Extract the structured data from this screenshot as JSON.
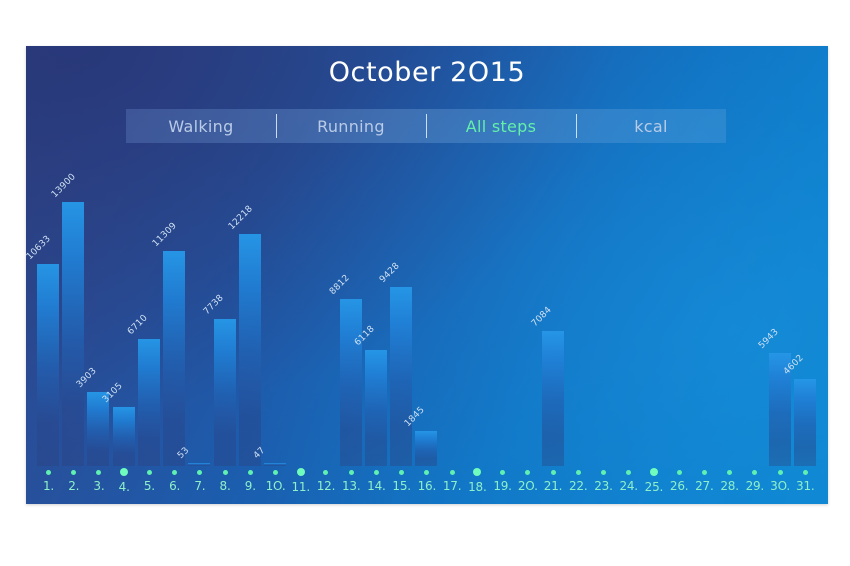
{
  "header": {
    "title": "October 2O15"
  },
  "tabs": [
    {
      "label": "Walking",
      "active": false
    },
    {
      "label": "Running",
      "active": false
    },
    {
      "label": "All steps",
      "active": true
    },
    {
      "label": "kcal",
      "active": false
    }
  ],
  "colors": {
    "accent_green": "#63f0a8",
    "dot_green": "#5ff0b2",
    "axis_label": "#8df0c8",
    "bar_blue": "#2696e6",
    "title_white": "#ffffff",
    "tab_inactive": "#b9cbe6",
    "panel_dark": "#2d4283",
    "panel_light": "#0c85d0"
  },
  "chart_data": {
    "type": "bar",
    "title": "October 2O15",
    "xlabel": "",
    "ylabel": "",
    "series_name": "All steps",
    "ylim": [
      0,
      13900
    ],
    "grid": false,
    "legend": "none",
    "categories": [
      "1.",
      "2.",
      "3.",
      "4.",
      "5.",
      "6.",
      "7.",
      "8.",
      "9.",
      "1O.",
      "11.",
      "12.",
      "13.",
      "14.",
      "15.",
      "16.",
      "17.",
      "18.",
      "19.",
      "2O.",
      "21.",
      "22.",
      "23.",
      "24.",
      "25.",
      "26.",
      "27.",
      "28.",
      "29.",
      "3O.",
      "31."
    ],
    "values": [
      10633,
      13900,
      3903,
      3105,
      6710,
      11309,
      53,
      7738,
      12218,
      47,
      0,
      0,
      8812,
      6118,
      9428,
      1845,
      0,
      0,
      0,
      0,
      7084,
      0,
      0,
      0,
      0,
      0,
      0,
      0,
      0,
      5943,
      4602
    ],
    "value_labels": [
      "10633",
      "13900",
      "3903",
      "3105",
      "6710",
      "11309",
      "53",
      "7738",
      "12218",
      "47",
      "",
      "",
      "8812",
      "6118",
      "9428",
      "1845",
      "",
      "",
      "",
      "",
      "7084",
      "",
      "",
      "",
      "",
      "",
      "",
      "",
      "",
      "5943",
      "4602"
    ],
    "highlight_days": [
      4,
      11,
      18,
      25
    ]
  }
}
